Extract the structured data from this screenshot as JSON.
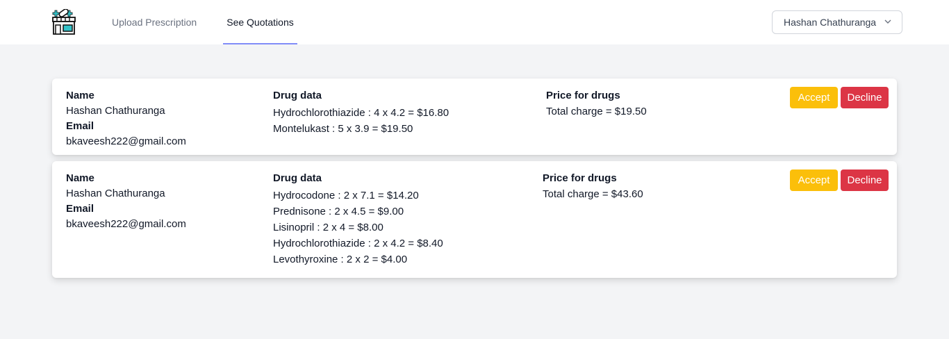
{
  "nav": {
    "links": [
      "Upload Prescription",
      "See Quotations"
    ],
    "active_link": "See Quotations",
    "user_name": "Hashan Chathuranga"
  },
  "labels": {
    "name": "Name",
    "email": "Email",
    "drug_data": "Drug data",
    "price_for_drugs": "Price for drugs",
    "accept": "Accept",
    "decline": "Decline"
  },
  "quotations": [
    {
      "name": "Hashan Chathuranga",
      "email": "bkaveesh222@gmail.com",
      "drugs": [
        "Hydrochlorothiazide : 4 x 4.2 = $16.80",
        "Montelukast : 5 x 3.9 = $19.50"
      ],
      "total": "Total charge = $19.50"
    },
    {
      "name": "Hashan Chathuranga",
      "email": "bkaveesh222@gmail.com",
      "drugs": [
        "Hydrocodone : 2 x 7.1 = $14.20",
        "Prednisone : 2 x 4.5 = $9.00",
        "Lisinopril : 2 x 4 = $8.00",
        "Hydrochlorothiazide : 2 x 4.2 = $8.40",
        "Levothyroxine : 2 x 2 = $4.00"
      ],
      "total": "Total charge = $43.60"
    }
  ],
  "colors": {
    "accept": "#fbbf0a",
    "decline": "#dc3545",
    "active_tab_underline": "#818cf8",
    "page_bg": "#f3f4f6"
  },
  "icons": [
    "pharmacy-store-icon",
    "chevron-down-icon"
  ]
}
